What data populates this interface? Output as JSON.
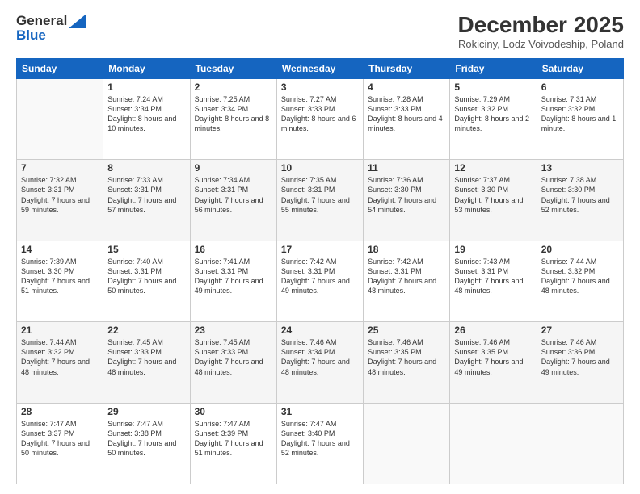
{
  "logo": {
    "general": "General",
    "blue": "Blue"
  },
  "header": {
    "month": "December 2025",
    "location": "Rokiciny, Lodz Voivodeship, Poland"
  },
  "weekdays": [
    "Sunday",
    "Monday",
    "Tuesday",
    "Wednesday",
    "Thursday",
    "Friday",
    "Saturday"
  ],
  "weeks": [
    [
      {
        "day": "",
        "sunrise": "",
        "sunset": "",
        "daylight": ""
      },
      {
        "day": "1",
        "sunrise": "Sunrise: 7:24 AM",
        "sunset": "Sunset: 3:34 PM",
        "daylight": "Daylight: 8 hours and 10 minutes."
      },
      {
        "day": "2",
        "sunrise": "Sunrise: 7:25 AM",
        "sunset": "Sunset: 3:34 PM",
        "daylight": "Daylight: 8 hours and 8 minutes."
      },
      {
        "day": "3",
        "sunrise": "Sunrise: 7:27 AM",
        "sunset": "Sunset: 3:33 PM",
        "daylight": "Daylight: 8 hours and 6 minutes."
      },
      {
        "day": "4",
        "sunrise": "Sunrise: 7:28 AM",
        "sunset": "Sunset: 3:33 PM",
        "daylight": "Daylight: 8 hours and 4 minutes."
      },
      {
        "day": "5",
        "sunrise": "Sunrise: 7:29 AM",
        "sunset": "Sunset: 3:32 PM",
        "daylight": "Daylight: 8 hours and 2 minutes."
      },
      {
        "day": "6",
        "sunrise": "Sunrise: 7:31 AM",
        "sunset": "Sunset: 3:32 PM",
        "daylight": "Daylight: 8 hours and 1 minute."
      }
    ],
    [
      {
        "day": "7",
        "sunrise": "Sunrise: 7:32 AM",
        "sunset": "Sunset: 3:31 PM",
        "daylight": "Daylight: 7 hours and 59 minutes."
      },
      {
        "day": "8",
        "sunrise": "Sunrise: 7:33 AM",
        "sunset": "Sunset: 3:31 PM",
        "daylight": "Daylight: 7 hours and 57 minutes."
      },
      {
        "day": "9",
        "sunrise": "Sunrise: 7:34 AM",
        "sunset": "Sunset: 3:31 PM",
        "daylight": "Daylight: 7 hours and 56 minutes."
      },
      {
        "day": "10",
        "sunrise": "Sunrise: 7:35 AM",
        "sunset": "Sunset: 3:31 PM",
        "daylight": "Daylight: 7 hours and 55 minutes."
      },
      {
        "day": "11",
        "sunrise": "Sunrise: 7:36 AM",
        "sunset": "Sunset: 3:30 PM",
        "daylight": "Daylight: 7 hours and 54 minutes."
      },
      {
        "day": "12",
        "sunrise": "Sunrise: 7:37 AM",
        "sunset": "Sunset: 3:30 PM",
        "daylight": "Daylight: 7 hours and 53 minutes."
      },
      {
        "day": "13",
        "sunrise": "Sunrise: 7:38 AM",
        "sunset": "Sunset: 3:30 PM",
        "daylight": "Daylight: 7 hours and 52 minutes."
      }
    ],
    [
      {
        "day": "14",
        "sunrise": "Sunrise: 7:39 AM",
        "sunset": "Sunset: 3:30 PM",
        "daylight": "Daylight: 7 hours and 51 minutes."
      },
      {
        "day": "15",
        "sunrise": "Sunrise: 7:40 AM",
        "sunset": "Sunset: 3:31 PM",
        "daylight": "Daylight: 7 hours and 50 minutes."
      },
      {
        "day": "16",
        "sunrise": "Sunrise: 7:41 AM",
        "sunset": "Sunset: 3:31 PM",
        "daylight": "Daylight: 7 hours and 49 minutes."
      },
      {
        "day": "17",
        "sunrise": "Sunrise: 7:42 AM",
        "sunset": "Sunset: 3:31 PM",
        "daylight": "Daylight: 7 hours and 49 minutes."
      },
      {
        "day": "18",
        "sunrise": "Sunrise: 7:42 AM",
        "sunset": "Sunset: 3:31 PM",
        "daylight": "Daylight: 7 hours and 48 minutes."
      },
      {
        "day": "19",
        "sunrise": "Sunrise: 7:43 AM",
        "sunset": "Sunset: 3:31 PM",
        "daylight": "Daylight: 7 hours and 48 minutes."
      },
      {
        "day": "20",
        "sunrise": "Sunrise: 7:44 AM",
        "sunset": "Sunset: 3:32 PM",
        "daylight": "Daylight: 7 hours and 48 minutes."
      }
    ],
    [
      {
        "day": "21",
        "sunrise": "Sunrise: 7:44 AM",
        "sunset": "Sunset: 3:32 PM",
        "daylight": "Daylight: 7 hours and 48 minutes."
      },
      {
        "day": "22",
        "sunrise": "Sunrise: 7:45 AM",
        "sunset": "Sunset: 3:33 PM",
        "daylight": "Daylight: 7 hours and 48 minutes."
      },
      {
        "day": "23",
        "sunrise": "Sunrise: 7:45 AM",
        "sunset": "Sunset: 3:33 PM",
        "daylight": "Daylight: 7 hours and 48 minutes."
      },
      {
        "day": "24",
        "sunrise": "Sunrise: 7:46 AM",
        "sunset": "Sunset: 3:34 PM",
        "daylight": "Daylight: 7 hours and 48 minutes."
      },
      {
        "day": "25",
        "sunrise": "Sunrise: 7:46 AM",
        "sunset": "Sunset: 3:35 PM",
        "daylight": "Daylight: 7 hours and 48 minutes."
      },
      {
        "day": "26",
        "sunrise": "Sunrise: 7:46 AM",
        "sunset": "Sunset: 3:35 PM",
        "daylight": "Daylight: 7 hours and 49 minutes."
      },
      {
        "day": "27",
        "sunrise": "Sunrise: 7:46 AM",
        "sunset": "Sunset: 3:36 PM",
        "daylight": "Daylight: 7 hours and 49 minutes."
      }
    ],
    [
      {
        "day": "28",
        "sunrise": "Sunrise: 7:47 AM",
        "sunset": "Sunset: 3:37 PM",
        "daylight": "Daylight: 7 hours and 50 minutes."
      },
      {
        "day": "29",
        "sunrise": "Sunrise: 7:47 AM",
        "sunset": "Sunset: 3:38 PM",
        "daylight": "Daylight: 7 hours and 50 minutes."
      },
      {
        "day": "30",
        "sunrise": "Sunrise: 7:47 AM",
        "sunset": "Sunset: 3:39 PM",
        "daylight": "Daylight: 7 hours and 51 minutes."
      },
      {
        "day": "31",
        "sunrise": "Sunrise: 7:47 AM",
        "sunset": "Sunset: 3:40 PM",
        "daylight": "Daylight: 7 hours and 52 minutes."
      },
      {
        "day": "",
        "sunrise": "",
        "sunset": "",
        "daylight": ""
      },
      {
        "day": "",
        "sunrise": "",
        "sunset": "",
        "daylight": ""
      },
      {
        "day": "",
        "sunrise": "",
        "sunset": "",
        "daylight": ""
      }
    ]
  ]
}
